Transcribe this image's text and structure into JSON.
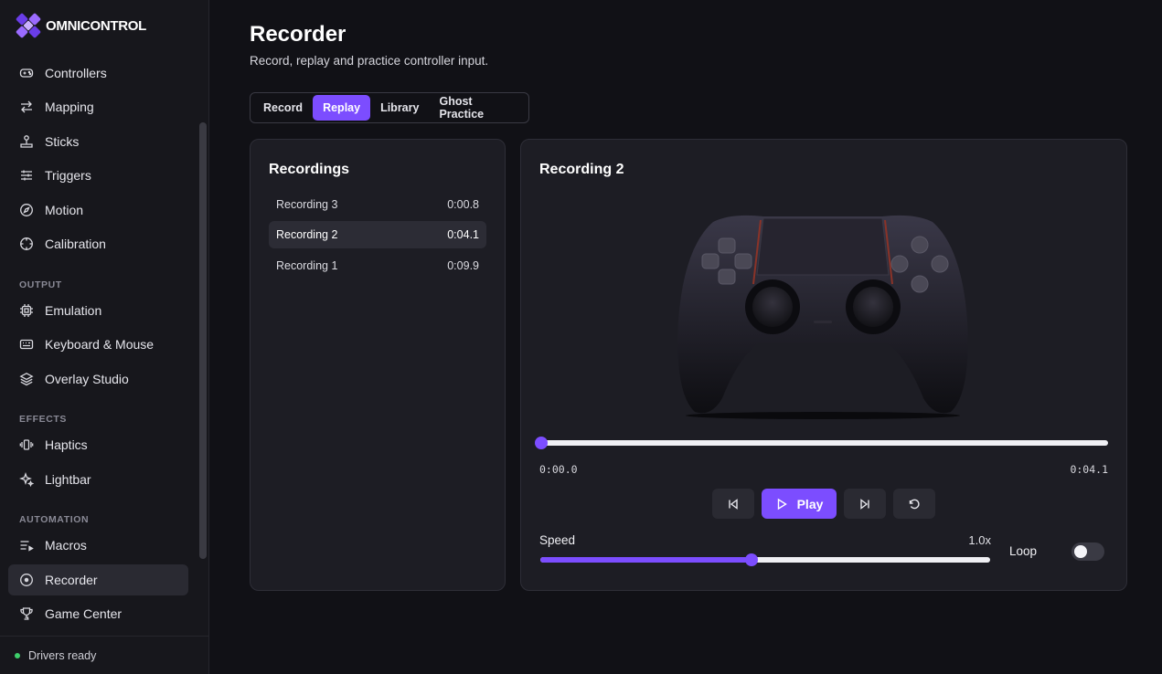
{
  "brand": {
    "name": "OMNICONTROL",
    "accent": "#7c4dff"
  },
  "sidebar": {
    "items_top": [
      {
        "label": "Controllers",
        "icon": "gamepad-icon"
      },
      {
        "label": "Mapping",
        "icon": "arrows-swap-icon"
      },
      {
        "label": "Sticks",
        "icon": "joystick-icon"
      },
      {
        "label": "Triggers",
        "icon": "sliders-icon"
      },
      {
        "label": "Motion",
        "icon": "compass-icon"
      },
      {
        "label": "Calibration",
        "icon": "crosshair-icon"
      }
    ],
    "section_output": "OUTPUT",
    "items_output": [
      {
        "label": "Emulation",
        "icon": "chip-icon"
      },
      {
        "label": "Keyboard & Mouse",
        "icon": "keyboard-icon"
      },
      {
        "label": "Overlay Studio",
        "icon": "layers-icon"
      }
    ],
    "section_effects": "EFFECTS",
    "items_effects": [
      {
        "label": "Haptics",
        "icon": "vibrate-icon"
      },
      {
        "label": "Lightbar",
        "icon": "sparkles-icon"
      }
    ],
    "section_automation": "AUTOMATION",
    "items_automation": [
      {
        "label": "Macros",
        "icon": "list-play-icon"
      },
      {
        "label": "Recorder",
        "icon": "record-icon"
      },
      {
        "label": "Game Center",
        "icon": "trophy-icon"
      }
    ],
    "status": "Drivers ready",
    "status_color": "#3ecf6b"
  },
  "header": {
    "title": "Recorder",
    "subtitle": "Record, replay and practice controller input."
  },
  "tabs": [
    "Record",
    "Replay",
    "Library",
    "Ghost Practice"
  ],
  "active_tab": "Replay",
  "recordings": {
    "title": "Recordings",
    "items": [
      {
        "name": "Recording 3",
        "duration": "0:00.8"
      },
      {
        "name": "Recording 2",
        "duration": "0:04.1"
      },
      {
        "name": "Recording 1",
        "duration": "0:09.9"
      }
    ],
    "selected": "Recording 2"
  },
  "player": {
    "title": "Recording 2",
    "time_current": "0:00.0",
    "time_total": "0:04.1",
    "progress": 0.0,
    "play_label": "Play",
    "speed_label": "Speed",
    "speed_value": "1.0x",
    "speed_fraction": 0.47,
    "loop_label": "Loop",
    "loop_on": false
  }
}
